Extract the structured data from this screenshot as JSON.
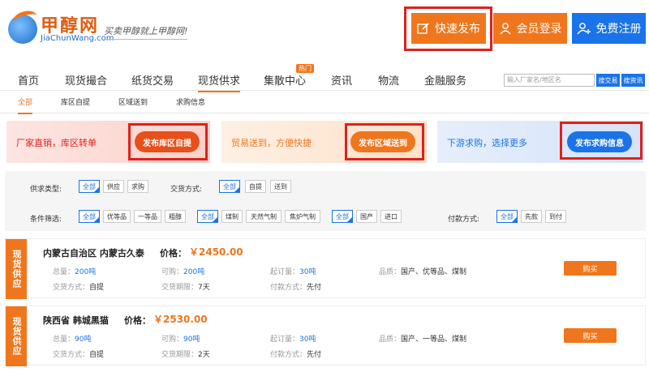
{
  "logo": {
    "cn": "甲醇网",
    "en": "JiaChunWang.com",
    "slogan": "买卖甲醇就上甲醇网!"
  },
  "header": {
    "publish": "快速发布",
    "login": "会员登录",
    "register": "免费注册"
  },
  "nav": {
    "items": [
      "首页",
      "现货撮合",
      "纸货交易",
      "现货供求",
      "集散中心",
      "资讯",
      "物流",
      "金融服务"
    ],
    "hot_badge": "热门",
    "search_placeholder": "输入厂家名/地区名",
    "search_btn1": "搜交易",
    "search_btn2": "搜资讯"
  },
  "subnav": [
    "全部",
    "库区自提",
    "区域送到",
    "求购信息"
  ],
  "banners": [
    {
      "text": "厂家直销，库区转单",
      "button": "发布库区自提"
    },
    {
      "text": "贸易送到，方便快捷",
      "button": "发布区域送到"
    },
    {
      "text": "下游求购，选择更多",
      "button": "发布求购信息"
    }
  ],
  "filters": {
    "supply_type_label": "供求类型:",
    "supply_type_options": [
      "全部",
      "供应",
      "求购"
    ],
    "trade_mode_label": "交货方式:",
    "trade_mode_options": [
      "全部",
      "自提",
      "送到"
    ],
    "condition_label": "条件筛选:",
    "grade_options": [
      "全部",
      "优等品",
      "一等品",
      "粗醇"
    ],
    "process_options": [
      "全部",
      "煤制",
      "天然气制",
      "焦炉气制"
    ],
    "origin_options": [
      "全部",
      "国产",
      "进口"
    ],
    "payment_label": "付款方式:",
    "payment_options": [
      "全部",
      "先款",
      "到付"
    ]
  },
  "listings": [
    {
      "tag": "现货供应",
      "location": "内蒙古自治区 内蒙古久泰",
      "price_label": "价格：",
      "price": "￥2450.00",
      "total_label": "总量：",
      "total": "200吨",
      "available_label": "可购：",
      "available": "200吨",
      "min_label": "起订量：",
      "min": "30吨",
      "quality_label": "品质：",
      "quality": "国产、优等品、煤制",
      "delivery_label": "交货方式：",
      "delivery": "自提",
      "period_label": "交货期限：",
      "period": "7天",
      "payment_label": "付款方式：",
      "payment": "先付",
      "buy": "购买"
    },
    {
      "tag": "现货供应",
      "location": "陕西省 韩城黑猫",
      "price_label": "价格：",
      "price": "￥2530.00",
      "total_label": "总量：",
      "total": "90吨",
      "available_label": "可购：",
      "available": "90吨",
      "min_label": "起订量：",
      "min": "30吨",
      "quality_label": "品质：",
      "quality": "国产、一等品、煤制",
      "delivery_label": "交货方式：",
      "delivery": "自提",
      "period_label": "交货期限：",
      "period": "2天",
      "payment_label": "付款方式：",
      "payment": "先付",
      "buy": "购买"
    }
  ],
  "colors": {
    "accent": "#f0761d",
    "primary": "#1a73e8",
    "highlight": "#e0201b"
  }
}
